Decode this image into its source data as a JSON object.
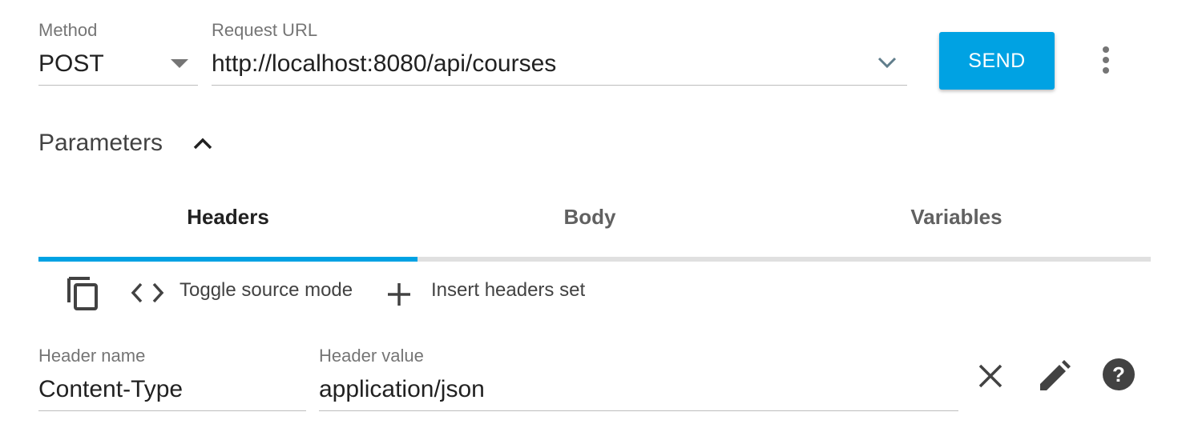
{
  "request": {
    "method_label": "Method",
    "method_value": "POST",
    "url_label": "Request URL",
    "url_value": "http://localhost:8080/api/courses",
    "send_label": "SEND"
  },
  "parameters": {
    "title": "Parameters",
    "expanded": true
  },
  "tabs": [
    {
      "label": "Headers",
      "active": true
    },
    {
      "label": "Body",
      "active": false
    },
    {
      "label": "Variables",
      "active": false
    }
  ],
  "toolbar": {
    "copy_icon": "copy-icon",
    "toggle_source_label": "Toggle source mode",
    "insert_headers_label": "Insert headers set"
  },
  "header_row": {
    "name_label": "Header name",
    "name_value": "Content-Type",
    "value_label": "Header value",
    "value_value": "application/json"
  },
  "colors": {
    "accent": "#00a2e3",
    "text_primary": "#212121",
    "text_secondary": "#757575"
  }
}
